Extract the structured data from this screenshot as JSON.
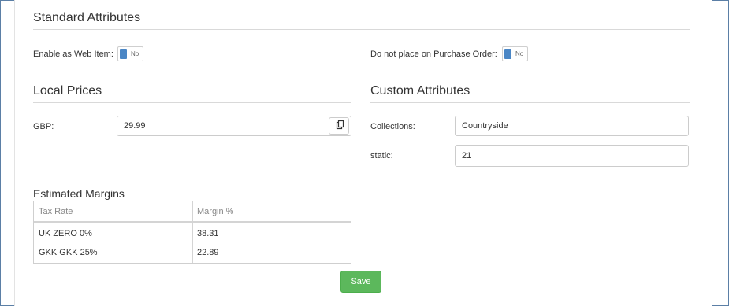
{
  "standard_attributes": {
    "title": "Standard Attributes",
    "web_item_label": "Enable as Web Item:",
    "web_item_value": "No",
    "purchase_order_label": "Do not place on Purchase Order:",
    "purchase_order_value": "No"
  },
  "local_prices": {
    "title": "Local Prices",
    "gbp_label": "GBP:",
    "gbp_value": "29.99",
    "copy_icon": "copy-icon"
  },
  "custom_attributes": {
    "title": "Custom Attributes",
    "collections_label": "Collections:",
    "collections_value": "Countryside",
    "static_label": "static:",
    "static_value": "21"
  },
  "estimated_margins": {
    "title": "Estimated Margins",
    "columns": [
      "Tax Rate",
      "Margin %"
    ],
    "rows": [
      [
        "UK ZERO 0%",
        "38.31"
      ],
      [
        "GKK GKK 25%",
        "22.89"
      ]
    ]
  },
  "actions": {
    "save_label": "Save",
    "save_color": "#5cb85c"
  }
}
